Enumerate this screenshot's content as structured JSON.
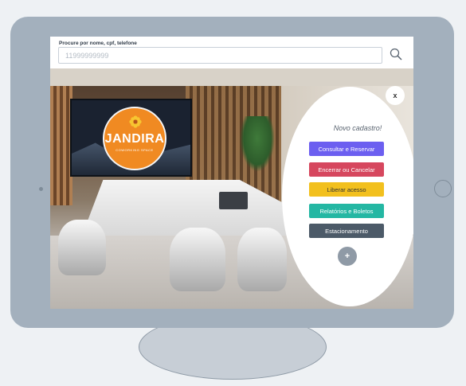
{
  "search": {
    "label": "Procure por nome, cpf, telefone",
    "placeholder": "11999999999"
  },
  "logo": {
    "name": "JANDIRA",
    "subtitle": "COWORKING SPACE"
  },
  "menu": {
    "close_label": "x",
    "title": "Novo cadastro!",
    "buttons": [
      {
        "label": "Consultar e Reservar",
        "color": "#6c5ff0"
      },
      {
        "label": "Encerrar ou Cancelar",
        "color": "#d6475e"
      },
      {
        "label": "Liberar acesso",
        "color": "#f2c01e"
      },
      {
        "label": "Relatórios e Boletos",
        "color": "#24b7a3"
      },
      {
        "label": "Estacionamento",
        "color": "#4c5a68"
      }
    ],
    "add_label": "+"
  },
  "icons": {
    "search": "search-icon",
    "flower": "flower-icon"
  },
  "colors": {
    "monitor": "#a3b0bd",
    "logo_orange": "#f08a22"
  }
}
